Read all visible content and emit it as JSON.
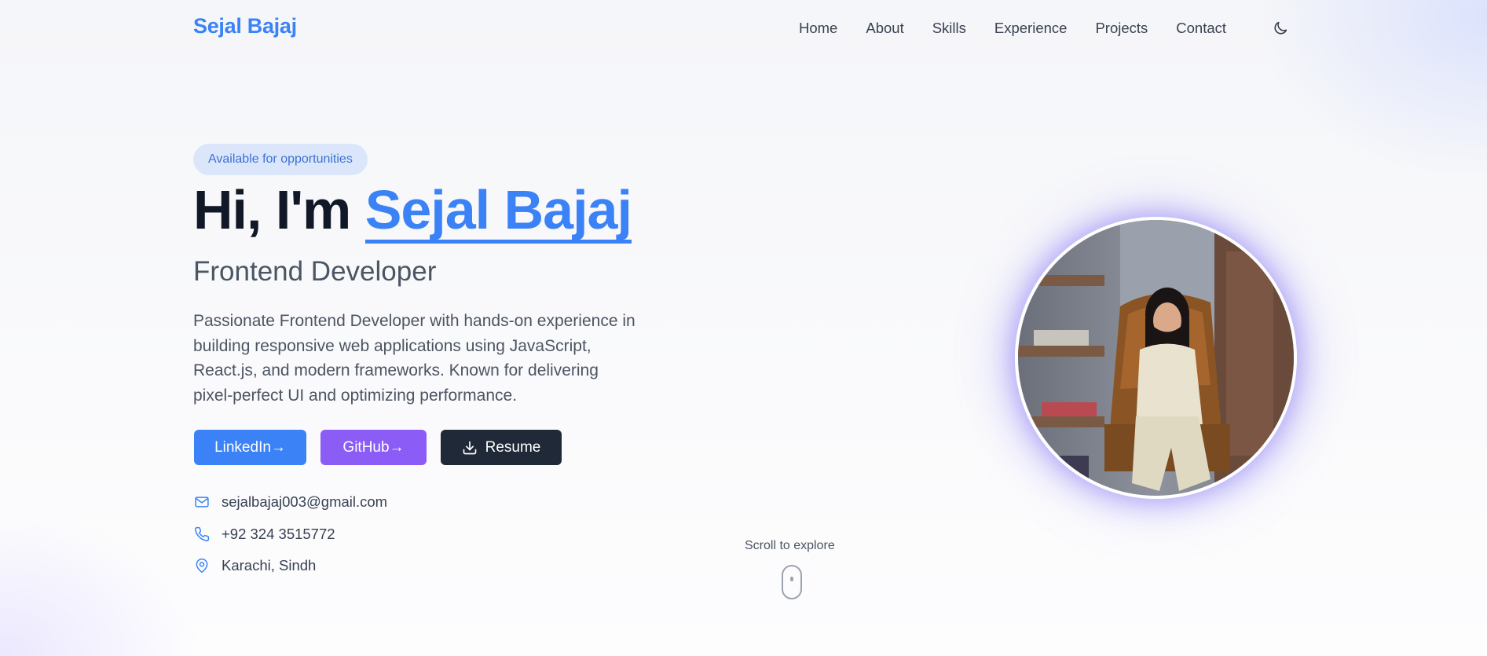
{
  "nav": {
    "brand": "Sejal Bajaj",
    "links": [
      "Home",
      "About",
      "Skills",
      "Experience",
      "Projects",
      "Contact"
    ],
    "theme_icon": "moon-icon"
  },
  "hero": {
    "badge": "Available for opportunities",
    "greeting": "Hi, I'm",
    "name": "Sejal Bajaj",
    "role": "Frontend Developer",
    "bio": "Passionate Frontend Developer with hands-on experience in building responsive web applications using JavaScript, React.js, and modern frameworks. Known for delivering pixel-perfect UI and optimizing performance.",
    "buttons": {
      "linkedin": "LinkedIn→",
      "github": "GitHub→",
      "resume": "Resume"
    },
    "contacts": [
      {
        "icon": "mail-icon",
        "text": "sejalbajaj003@gmail.com"
      },
      {
        "icon": "phone-icon",
        "text": "+92 324 3515772"
      },
      {
        "icon": "map-pin-icon",
        "text": "Karachi, Sindh"
      }
    ]
  },
  "scroll_hint": "Scroll to explore",
  "colors": {
    "accent": "#3b82f6",
    "purple": "#8b5cf6",
    "dark": "#1f2937"
  }
}
